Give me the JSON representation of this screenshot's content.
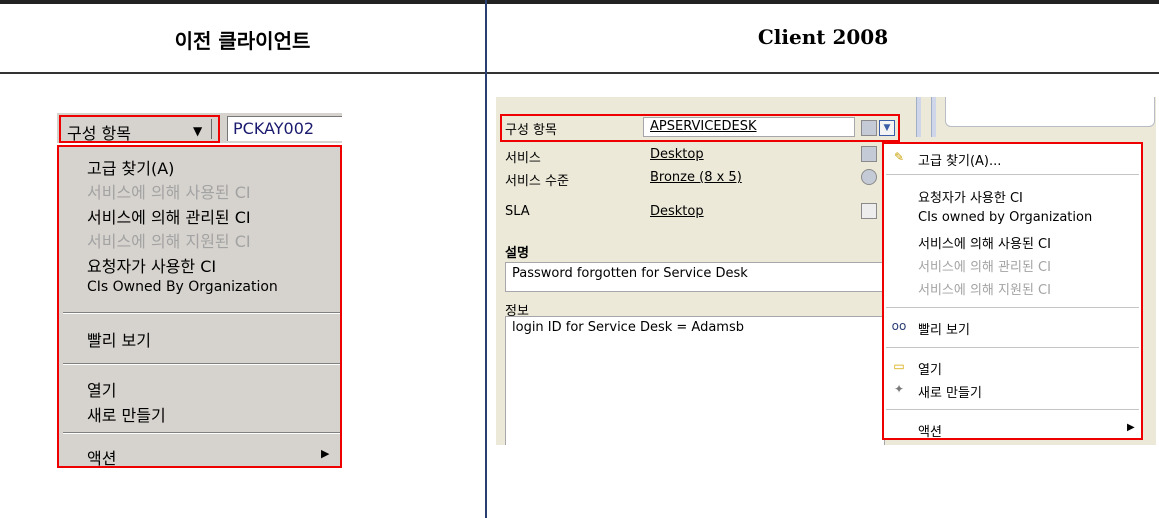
{
  "headers": {
    "left": "이전 클라이언트",
    "right": "Client 2008"
  },
  "legacy": {
    "combo_label": "구성 항목",
    "combo_value": "PCKAY002",
    "menu": {
      "advanced_find": "고급 찾기(A)",
      "used_by_service": "서비스에 의해 사용된 CI",
      "managed_by_service": "서비스에 의해 관리된 CI",
      "supported_by_service": "서비스에 의해 지원된 CI",
      "used_by_requester": "요청자가 사용한 CI",
      "owned_by_org": "CIs Owned By Organization",
      "quick_view": "빨리 보기",
      "open": "열기",
      "new": "새로 만들기",
      "actions": "액션"
    }
  },
  "client2008": {
    "fields": {
      "ci_label": "구성 항목",
      "ci_value": "APSERVICEDESK",
      "service_label": "서비스",
      "service_value": "Desktop",
      "level_label": "서비스 수준",
      "level_value": "Bronze (8 x 5)",
      "sla_label": "SLA",
      "sla_value": "Desktop",
      "description_label": "설명",
      "description_value": "Password forgotten for Service Desk",
      "info_label": "정보",
      "info_value": "login ID for Service Desk = Adamsb"
    },
    "menu": {
      "advanced_find": "고급 찾기(A)...",
      "used_by_requester": "요청자가 사용한 CI",
      "owned_by_org": "CIs owned by Organization",
      "used_by_service": "서비스에 의해 사용된 CI",
      "managed_by_service": "서비스에 의해 관리된 CI",
      "supported_by_service": "서비스에 의해 지원된 CI",
      "quick_view": "빨리 보기",
      "open": "열기",
      "new": "새로 만들기",
      "actions": "액션"
    }
  },
  "colors": {
    "highlight": "#e00000",
    "legacy_bg": "#d6d3ce",
    "panel_bg": "#ece9d8",
    "divider": "#2a3e72"
  },
  "icons": [
    "dropdown-arrow-icon",
    "magnifier-icon",
    "glasses-icon",
    "folder-icon",
    "new-item-icon",
    "submenu-arrow-icon"
  ]
}
